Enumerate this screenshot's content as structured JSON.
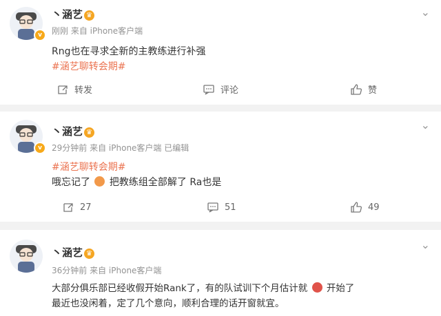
{
  "posts": [
    {
      "user_name": "丶涵艺",
      "time": "刚刚",
      "source": "来自 iPhone客户端",
      "edited": "",
      "lines": [
        "Rng也在寻求全新的主教练进行补强",
        "#涵艺聊转会期#"
      ],
      "actions": {
        "repost": "转发",
        "comment": "评论",
        "like": "赞"
      }
    },
    {
      "user_name": "丶涵艺",
      "time": "29分钟前",
      "source": "来自 iPhone客户端",
      "edited": "已编辑",
      "tag": "#涵艺聊转会期#",
      "text_before": "哦忘记了",
      "text_after": "把教练组全部解了  Ra也是",
      "actions": {
        "repost": "27",
        "comment": "51",
        "like": "49"
      }
    },
    {
      "user_name": "丶涵艺",
      "time": "36分钟前",
      "source": "来自 iPhone客户端",
      "line1_before": "大部分俱乐部已经收假开始Rank了，有的队试训下个月估计就",
      "line1_after": "开始了",
      "line2": "最近也没闲着，定了几个意向，顺利合理的话开窗就宜。"
    }
  ],
  "colors": {
    "tag": "#eb7350",
    "meta": "#939393",
    "badge": "#f7a91a"
  },
  "icons": [
    "chevron-down-icon",
    "repost-icon",
    "comment-icon",
    "like-icon",
    "verified-badge-icon",
    "crown-icon"
  ]
}
